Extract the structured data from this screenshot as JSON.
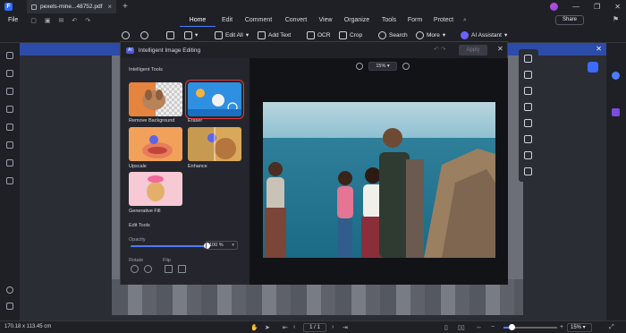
{
  "tab": {
    "filename": "pexels-mine...48752.pdf"
  },
  "menu": {
    "file": "File",
    "items": [
      "Home",
      "Edit",
      "Comment",
      "Convert",
      "View",
      "Organize",
      "Tools",
      "Form",
      "Protect"
    ],
    "share": "Share"
  },
  "toolbar": {
    "edit_all": "Edit All",
    "add_text": "Add Text",
    "ocr": "OCR",
    "crop": "Crop",
    "search": "Search",
    "more": "More",
    "ai_assistant": "AI Assistant"
  },
  "dialog": {
    "badge": "AI",
    "title": "Intelligent Image Editing",
    "apply": "Apply",
    "zoom": "15%",
    "sections": {
      "tools": "Intelligent Tools",
      "edit": "Edit Tools"
    },
    "tools": [
      {
        "label": "Remove Background"
      },
      {
        "label": "Eraser"
      },
      {
        "label": "Upscale"
      },
      {
        "label": "Enhance"
      },
      {
        "label": "Generative Fill"
      }
    ],
    "opacity_label": "Opacity",
    "opacity_value": "100 %",
    "opacity_level": 1.0,
    "rotate_label": "Rotate",
    "flip_label": "Flip"
  },
  "status": {
    "dimensions": "170.18 x 113.45 cm",
    "page": "1 / 1",
    "zoom": "15%"
  },
  "colors": {
    "accent": "#4f7bff",
    "banner": "#2d4ba8",
    "selection": "#e33b3b"
  }
}
